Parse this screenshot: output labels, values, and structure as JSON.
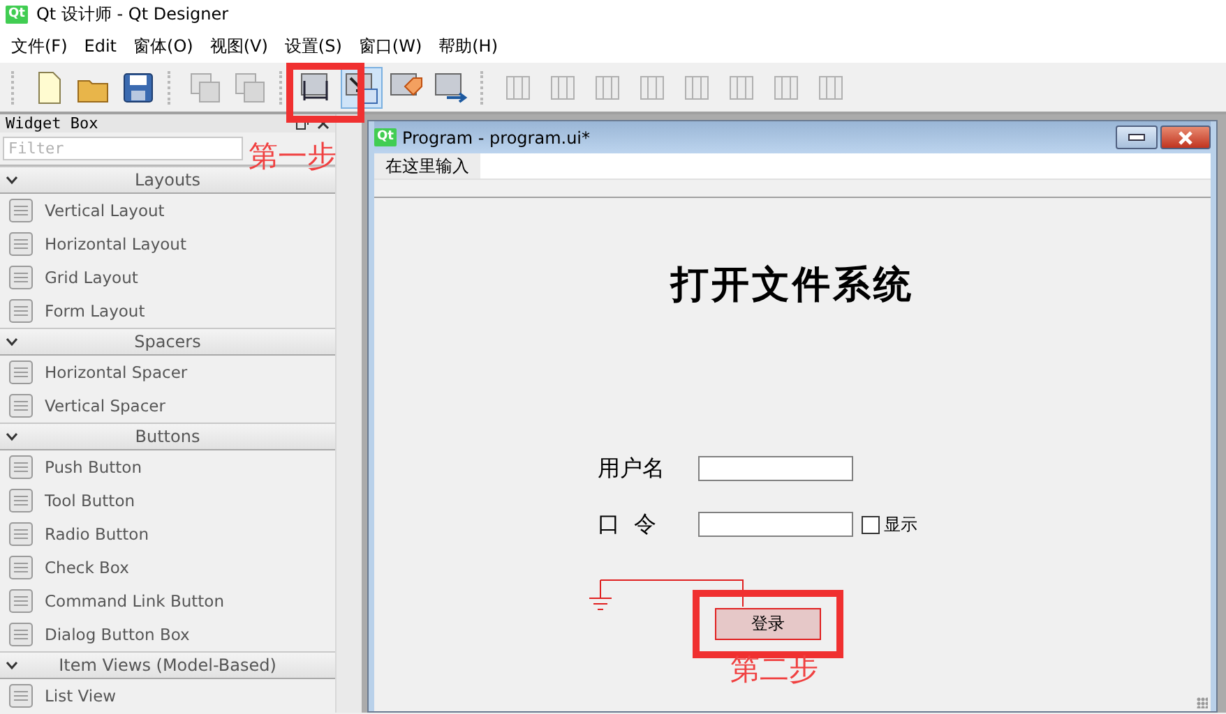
{
  "window": {
    "logo": "Qt",
    "title": "Qt 设计师 - Qt Designer"
  },
  "menu": [
    "文件(F)",
    "Edit",
    "窗体(O)",
    "视图(V)",
    "设置(S)",
    "窗口(W)",
    "帮助(H)"
  ],
  "toolbar_groups": [
    {
      "kind": "file",
      "items": [
        {
          "selected": false
        },
        {
          "selected": false
        },
        {
          "selected": false
        }
      ]
    },
    {
      "kind": "arrange",
      "items": [
        {
          "selected": false
        },
        {
          "selected": false
        }
      ]
    },
    {
      "kind": "mode",
      "items": [
        {
          "selected": false
        },
        {
          "selected": true
        },
        {
          "selected": false
        },
        {
          "selected": false
        }
      ]
    },
    {
      "kind": "layout",
      "items": [
        {
          "selected": false
        },
        {
          "selected": false
        },
        {
          "selected": false
        },
        {
          "selected": false
        },
        {
          "selected": false
        },
        {
          "selected": false
        },
        {
          "selected": false
        },
        {
          "selected": false
        }
      ]
    }
  ],
  "widget_box": {
    "title": "Widget Box",
    "filter_placeholder": "Filter",
    "sections": [
      {
        "title": "Layouts",
        "expanded": true,
        "items": [
          "Vertical Layout",
          "Horizontal Layout",
          "Grid Layout",
          "Form Layout"
        ]
      },
      {
        "title": "Spacers",
        "expanded": true,
        "items": [
          "Horizontal Spacer",
          "Vertical Spacer"
        ]
      },
      {
        "title": "Buttons",
        "expanded": true,
        "items": [
          "Push Button",
          "Tool Button",
          "Radio Button",
          "Check Box",
          "Command Link Button",
          "Dialog Button Box"
        ]
      },
      {
        "title": "Item Views (Model-Based)",
        "expanded": true,
        "items": [
          "List View"
        ]
      }
    ]
  },
  "form_window": {
    "logo": "Qt",
    "title": "Program - program.ui*",
    "menu_placeholder": "在这里输入",
    "heading": "打开文件系统",
    "fields": [
      {
        "label": "用户名"
      },
      {
        "label": "口  令",
        "checkbox": {
          "label": "显示",
          "checked": false
        }
      }
    ],
    "button": "登录"
  },
  "annotations": [
    "第一步",
    "第二步"
  ]
}
